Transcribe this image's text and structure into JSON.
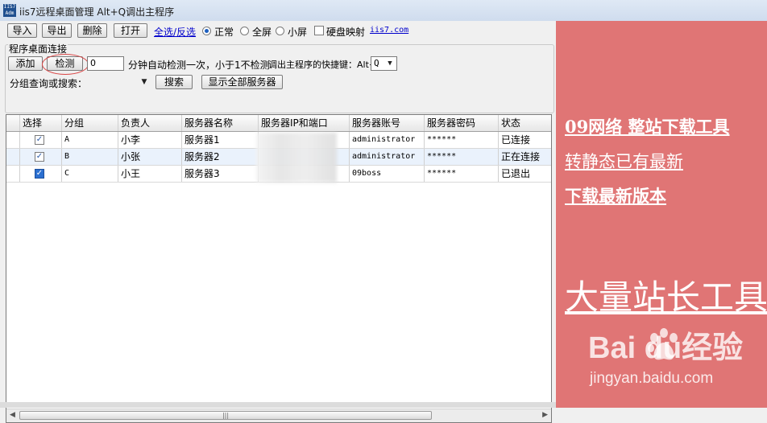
{
  "window": {
    "title": "iis7远程桌面管理 Alt+Q调出主程序",
    "icon_text": "IIS7 Adm"
  },
  "toolbar": {
    "import_label": "导入",
    "export_label": "导出",
    "delete_label": "删除",
    "open_label": "打开",
    "select_all_link": "全选/反选",
    "view_modes": [
      {
        "label": "正常",
        "selected": true
      },
      {
        "label": "全屏",
        "selected": false
      },
      {
        "label": "小屏",
        "selected": false
      }
    ],
    "disk_mapping_label": "硬盘映射",
    "disk_mapping_checked": false,
    "site_link": "iis7.com"
  },
  "connection_group": {
    "title": "程序桌面连接",
    "add_label": "添加",
    "check_label": "检测",
    "interval_value": "0",
    "interval_text": "分钟自动检测一次，小于1不检测",
    "hotkey_text": "调出主程序的快捷键：Alt+",
    "hotkey_value": "Q",
    "search_label": "分组查询或搜索：",
    "search_value": "",
    "search_button": "搜索",
    "show_all_button": "显示全部服务器"
  },
  "table": {
    "columns": [
      "选择",
      "分组",
      "负责人",
      "服务器名称",
      "服务器IP和端口",
      "服务器账号",
      "服务器密码",
      "状态"
    ],
    "rows": [
      {
        "checked": true,
        "group": "A",
        "owner": "小李",
        "name": "服务器1",
        "ip": "",
        "account": "administrator",
        "password": "******",
        "status": "已连接",
        "selected": false
      },
      {
        "checked": true,
        "group": "B",
        "owner": "小张",
        "name": "服务器2",
        "ip": "",
        "account": "administrator",
        "password": "******",
        "status": "正在连接",
        "selected": true
      },
      {
        "checked": true,
        "group": "C",
        "owner": "小王",
        "name": "服务器3",
        "ip": "",
        "account": "09boss",
        "password": "******",
        "status": "已退出",
        "selected": false
      }
    ]
  },
  "ad_panel": {
    "background": "#e07575",
    "line1": "09网络 整站下载工具",
    "line2": "转静态已有最新",
    "line3": "下载最新版本",
    "big_text": "大量站长工具",
    "watermark_brand": "Bai du经验",
    "watermark_url": "jingyan.baidu.com"
  }
}
